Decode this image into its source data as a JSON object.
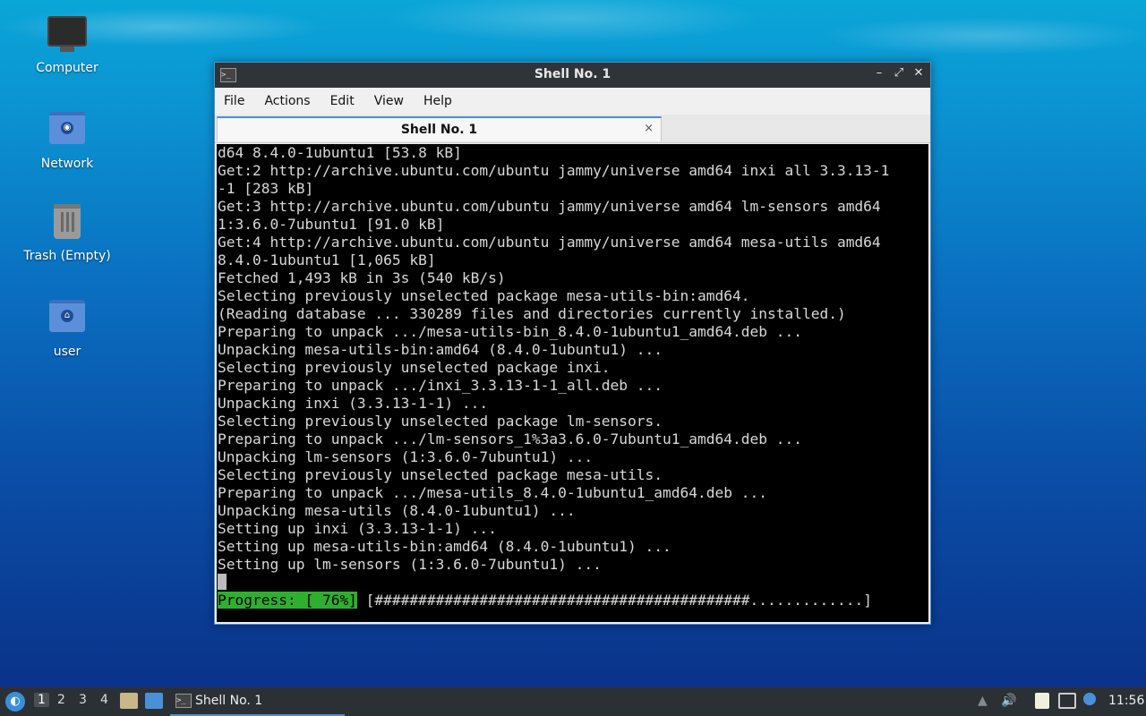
{
  "desktop": {
    "icons": [
      {
        "label": "Computer",
        "icon": "computer-icon"
      },
      {
        "label": "Network",
        "icon": "network-folder-icon"
      },
      {
        "label": "Trash (Empty)",
        "icon": "trash-icon"
      },
      {
        "label": "user",
        "icon": "home-folder-icon"
      }
    ]
  },
  "window": {
    "title": "Shell No. 1",
    "menu": [
      "File",
      "Actions",
      "Edit",
      "View",
      "Help"
    ],
    "tab_label": "Shell No. 1",
    "tab_close": "×",
    "controls": {
      "minimize": "–",
      "maximize": "⤢",
      "close": "✕"
    }
  },
  "terminal": {
    "lines": [
      "d64 8.4.0-1ubuntu1 [53.8 kB]",
      "Get:2 http://archive.ubuntu.com/ubuntu jammy/universe amd64 inxi all 3.3.13-1",
      "-1 [283 kB]",
      "Get:3 http://archive.ubuntu.com/ubuntu jammy/universe amd64 lm-sensors amd64",
      "1:3.6.0-7ubuntu1 [91.0 kB]",
      "Get:4 http://archive.ubuntu.com/ubuntu jammy/universe amd64 mesa-utils amd64",
      "8.4.0-1ubuntu1 [1,065 kB]",
      "Fetched 1,493 kB in 3s (540 kB/s)",
      "Selecting previously unselected package mesa-utils-bin:amd64.",
      "(Reading database ... 330289 files and directories currently installed.)",
      "Preparing to unpack .../mesa-utils-bin_8.4.0-1ubuntu1_amd64.deb ...",
      "Unpacking mesa-utils-bin:amd64 (8.4.0-1ubuntu1) ...",
      "Selecting previously unselected package inxi.",
      "Preparing to unpack .../inxi_3.3.13-1-1_all.deb ...",
      "Unpacking inxi (3.3.13-1-1) ...",
      "Selecting previously unselected package lm-sensors.",
      "Preparing to unpack .../lm-sensors_1%3a3.6.0-7ubuntu1_amd64.deb ...",
      "Unpacking lm-sensors (1:3.6.0-7ubuntu1) ...",
      "Selecting previously unselected package mesa-utils.",
      "Preparing to unpack .../mesa-utils_8.4.0-1ubuntu1_amd64.deb ...",
      "Unpacking mesa-utils (8.4.0-1ubuntu1) ...",
      "Setting up inxi (3.3.13-1-1) ...",
      "Setting up mesa-utils-bin:amd64 (8.4.0-1ubuntu1) ...",
      "Setting up lm-sensors (1:3.6.0-7ubuntu1) ..."
    ],
    "progress_label": "Progress: [ 76%]",
    "progress_bar": " [###########################################.............]",
    "progress_percent": 76
  },
  "taskbar": {
    "workspaces": [
      "1",
      "2",
      "3",
      "4"
    ],
    "active_workspace": "1",
    "task_label": "Shell No. 1",
    "clock": "11:56"
  }
}
